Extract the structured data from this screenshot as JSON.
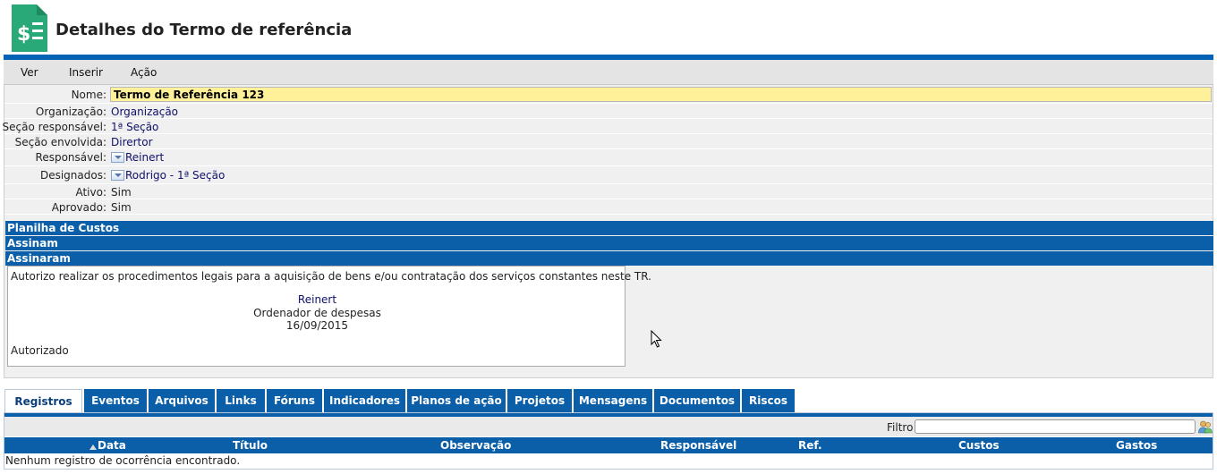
{
  "page": {
    "title": "Detalhes do Termo de referência",
    "logo_icon": "cost-document-icon"
  },
  "menu": {
    "items": [
      "Ver",
      "Inserir",
      "Ação"
    ]
  },
  "details": {
    "fields": [
      {
        "label": "Nome:",
        "value": "Termo de Referência 123"
      },
      {
        "label": "Organização:",
        "value": "Organização"
      },
      {
        "label": "Seção responsável:",
        "value": "1ª Seção"
      },
      {
        "label": "Seção envolvida:",
        "value": "Dirertor"
      },
      {
        "label": "Responsável:",
        "value": "Reinert"
      },
      {
        "label": "Designados:",
        "value": "Rodrigo - 1ª Seção"
      },
      {
        "label": "Ativo:",
        "value": "Sim"
      },
      {
        "label": "Aprovado:",
        "value": "Sim"
      }
    ]
  },
  "sections": [
    "Planilha de Custos",
    "Assinam",
    "Assinaram"
  ],
  "signature": {
    "statement": "Autorizo realizar os procedimentos legais para a aquisição de bens e/ou contratação dos serviços constantes neste TR.",
    "signer": "Reinert",
    "role": "Ordenador de despesas",
    "date": "16/09/2015",
    "status": "Autorizado"
  },
  "tabs": [
    "Registros",
    "Eventos",
    "Arquivos",
    "Links",
    "Fóruns",
    "Indicadores",
    "Planos de ação",
    "Projetos",
    "Mensagens",
    "Documentos",
    "Riscos"
  ],
  "active_tab": "Registros",
  "filter": {
    "label": "Filtro",
    "value": ""
  },
  "table": {
    "columns": [
      "Data",
      "Título",
      "Observação",
      "Responsável",
      "Ref.",
      "Custos",
      "Gastos"
    ],
    "empty_message": "Nenhum registro de ocorrência encontrado."
  },
  "colors": {
    "accent": "#0a5fa8",
    "highlight": "#fef19a",
    "link": "#10106a"
  }
}
